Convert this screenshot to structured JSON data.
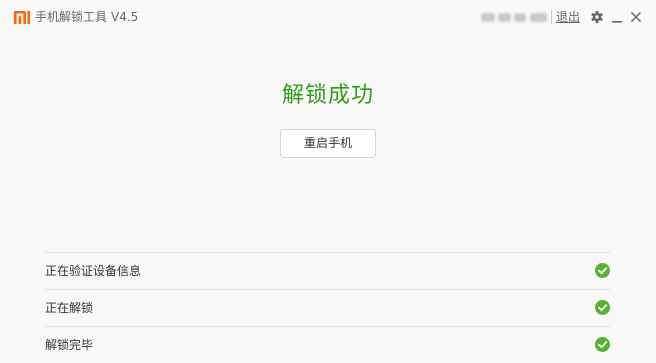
{
  "window": {
    "logo_icon": "mi-logo-icon",
    "brand_color": "#ff6700",
    "title": "手机解锁工具",
    "version": "V4.5",
    "logout_label": "退出",
    "controls": [
      "settings-icon",
      "minimize-icon",
      "close-icon"
    ]
  },
  "result": {
    "title": "解锁成功",
    "title_color": "#2e9d16",
    "restart_button_label": "重启手机"
  },
  "steps": [
    {
      "label": "正在验证设备信息",
      "status": "done",
      "icon": "check-circle-icon"
    },
    {
      "label": "正在解锁",
      "status": "done",
      "icon": "check-circle-icon"
    },
    {
      "label": "解锁完毕",
      "status": "done",
      "icon": "check-circle-icon"
    }
  ],
  "status_color": "#56b22f"
}
